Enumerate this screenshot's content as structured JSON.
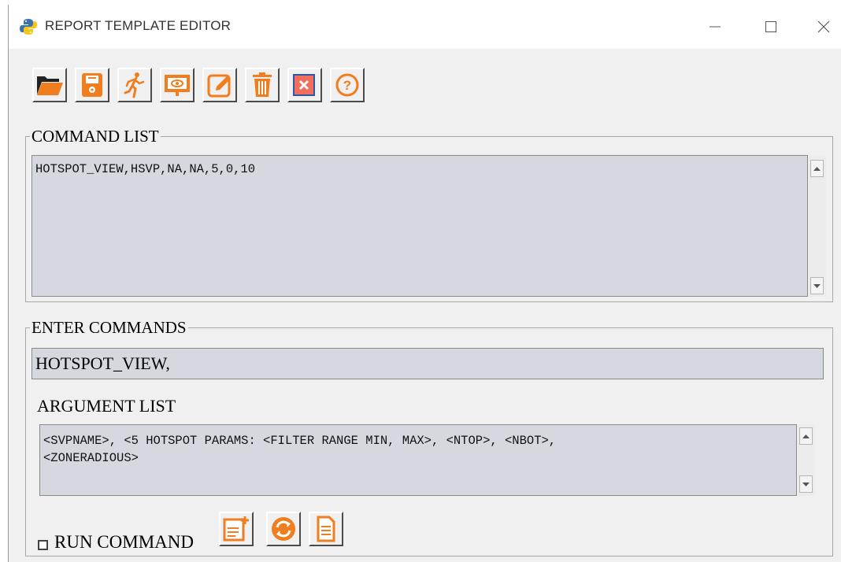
{
  "window": {
    "title": "REPORT TEMPLATE EDITOR",
    "controls": [
      "minimize",
      "maximize",
      "close"
    ]
  },
  "toolbar": {
    "buttons": [
      {
        "name": "open-folder",
        "icon": "folder-open-icon"
      },
      {
        "name": "save",
        "icon": "floppy-disk-icon"
      },
      {
        "name": "run",
        "icon": "running-person-icon"
      },
      {
        "name": "preview",
        "icon": "eye-screen-icon"
      },
      {
        "name": "edit",
        "icon": "pencil-edit-icon"
      },
      {
        "name": "delete",
        "icon": "trash-can-icon"
      },
      {
        "name": "clear",
        "icon": "close-box-icon"
      },
      {
        "name": "help",
        "icon": "question-icon"
      }
    ],
    "accent": "#f07d1e"
  },
  "command_list": {
    "label": "COMMAND LIST",
    "lines": [
      "HOTSPOT_VIEW,HSVP,NA,NA,5,0,10"
    ]
  },
  "enter_commands": {
    "label": "ENTER COMMANDS",
    "value": "HOTSPOT_VIEW,"
  },
  "argument_list": {
    "label": "ARGUMENT LIST",
    "lines": [
      "<SVPNAME>, <5 HOTSPOT PARAMS: <FILTER RANGE MIN, MAX>, <NTOP>, <NBOT>,",
      "<ZONERADIOUS>"
    ]
  },
  "run_command": {
    "label": "RUN COMMAND",
    "checked": false
  },
  "bottom_buttons": [
    {
      "name": "add-document",
      "icon": "add-document-icon"
    },
    {
      "name": "refresh",
      "icon": "refresh-icon"
    },
    {
      "name": "document",
      "icon": "document-icon"
    }
  ],
  "colors": {
    "panel_bg": "#f0f0f0",
    "field_bg": "#d6d8e0",
    "icon_orange": "#f07d1e"
  }
}
